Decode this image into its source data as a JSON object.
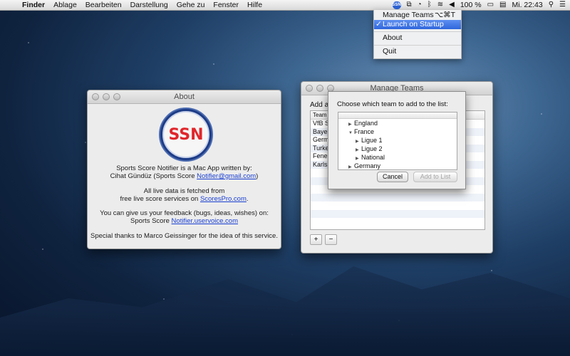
{
  "menubar": {
    "finder": "Finder",
    "items": [
      "Ablage",
      "Bearbeiten",
      "Darstellung",
      "Gehe zu",
      "Fenster",
      "Hilfe"
    ],
    "battery": "100 %",
    "clock": "Mi. 22:43",
    "status_app_label": "SSN"
  },
  "dropdown": {
    "manage_teams": "Manage Teams",
    "manage_teams_shortcut": "⌥⌘T",
    "launch_on_startup": "Launch on Startup",
    "check": "✓",
    "about": "About",
    "quit": "Quit"
  },
  "about_window": {
    "title": "About",
    "logo_text": "SSN",
    "line1": "Sports Score Notifier is a Mac App written by:",
    "line2_prefix": "Cihat Gündüz (Sports Score ",
    "line2_link": "Notifier@gmail.com",
    "line2_suffix": ")",
    "line3": "All live data is fetched from",
    "line4_prefix": "free live score services on ",
    "line4_link": "ScoresPro.com",
    "line4_suffix": ".",
    "line5": "You can give us your feedback (bugs, ideas, wishes) on:",
    "line6_prefix": "Sports Score ",
    "line6_link": "Notifier.uservoice.com",
    "line7": "Special thanks to Marco Geissinger for the idea of this service."
  },
  "manage_window": {
    "title": "Manage Teams",
    "label": "Add an",
    "column_header": "Team N",
    "teams": [
      "VfB St",
      "Bayern",
      "Germa",
      "Turkey",
      "Fenerb",
      "Karlsr"
    ],
    "add_button": "+",
    "remove_button": "−"
  },
  "sheet": {
    "prompt": "Choose which team to add to the list:",
    "tree": [
      {
        "label": "England",
        "expanded": false,
        "level": 0
      },
      {
        "label": "France",
        "expanded": true,
        "level": 0
      },
      {
        "label": "Ligue 1",
        "expanded": false,
        "level": 1
      },
      {
        "label": "Ligue 2",
        "expanded": false,
        "level": 1
      },
      {
        "label": "National",
        "expanded": false,
        "level": 1
      },
      {
        "label": "Germany",
        "expanded": false,
        "level": 0
      }
    ],
    "cancel": "Cancel",
    "add_to_list": "Add to List"
  }
}
